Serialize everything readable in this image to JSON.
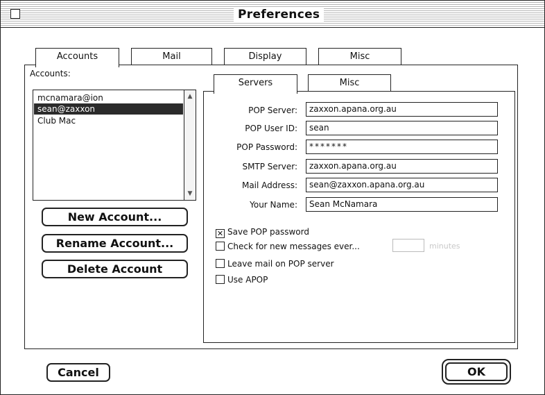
{
  "window": {
    "title": "Preferences"
  },
  "top_tabs": [
    {
      "label": "Accounts",
      "active": true
    },
    {
      "label": "Mail",
      "active": false
    },
    {
      "label": "Display",
      "active": false
    },
    {
      "label": "Misc",
      "active": false
    }
  ],
  "accounts": {
    "label": "Accounts:",
    "items": [
      {
        "name": "mcnamara@ion",
        "selected": false
      },
      {
        "name": "sean@zaxxon",
        "selected": true
      },
      {
        "name": "Club Mac",
        "selected": false
      }
    ],
    "buttons": {
      "new": "New Account...",
      "rename": "Rename Account...",
      "delete": "Delete Account"
    }
  },
  "sub_tabs": [
    {
      "label": "Servers",
      "active": true
    },
    {
      "label": "Misc",
      "active": false
    }
  ],
  "servers": {
    "pop_server": {
      "label": "POP Server:",
      "value": "zaxxon.apana.org.au"
    },
    "pop_user_id": {
      "label": "POP User ID:",
      "value": "sean"
    },
    "pop_password": {
      "label": "POP Password:",
      "value": "*******"
    },
    "smtp_server": {
      "label": "SMTP Server:",
      "value": "zaxxon.apana.org.au"
    },
    "mail_address": {
      "label": "Mail Address:",
      "value": "sean@zaxxon.apana.org.au"
    },
    "your_name": {
      "label": "Your Name:",
      "value": "Sean McNamara"
    }
  },
  "options": {
    "save_pop_password": {
      "label": "Save POP password",
      "checked": true
    },
    "check_new_messages": {
      "label": "Check for new messages ever...",
      "checked": false,
      "suffix": "minutes"
    },
    "leave_mail": {
      "label": "Leave mail on POP server",
      "checked": false
    },
    "use_apop": {
      "label": "Use APOP",
      "checked": false
    }
  },
  "footer": {
    "cancel": "Cancel",
    "ok": "OK"
  }
}
